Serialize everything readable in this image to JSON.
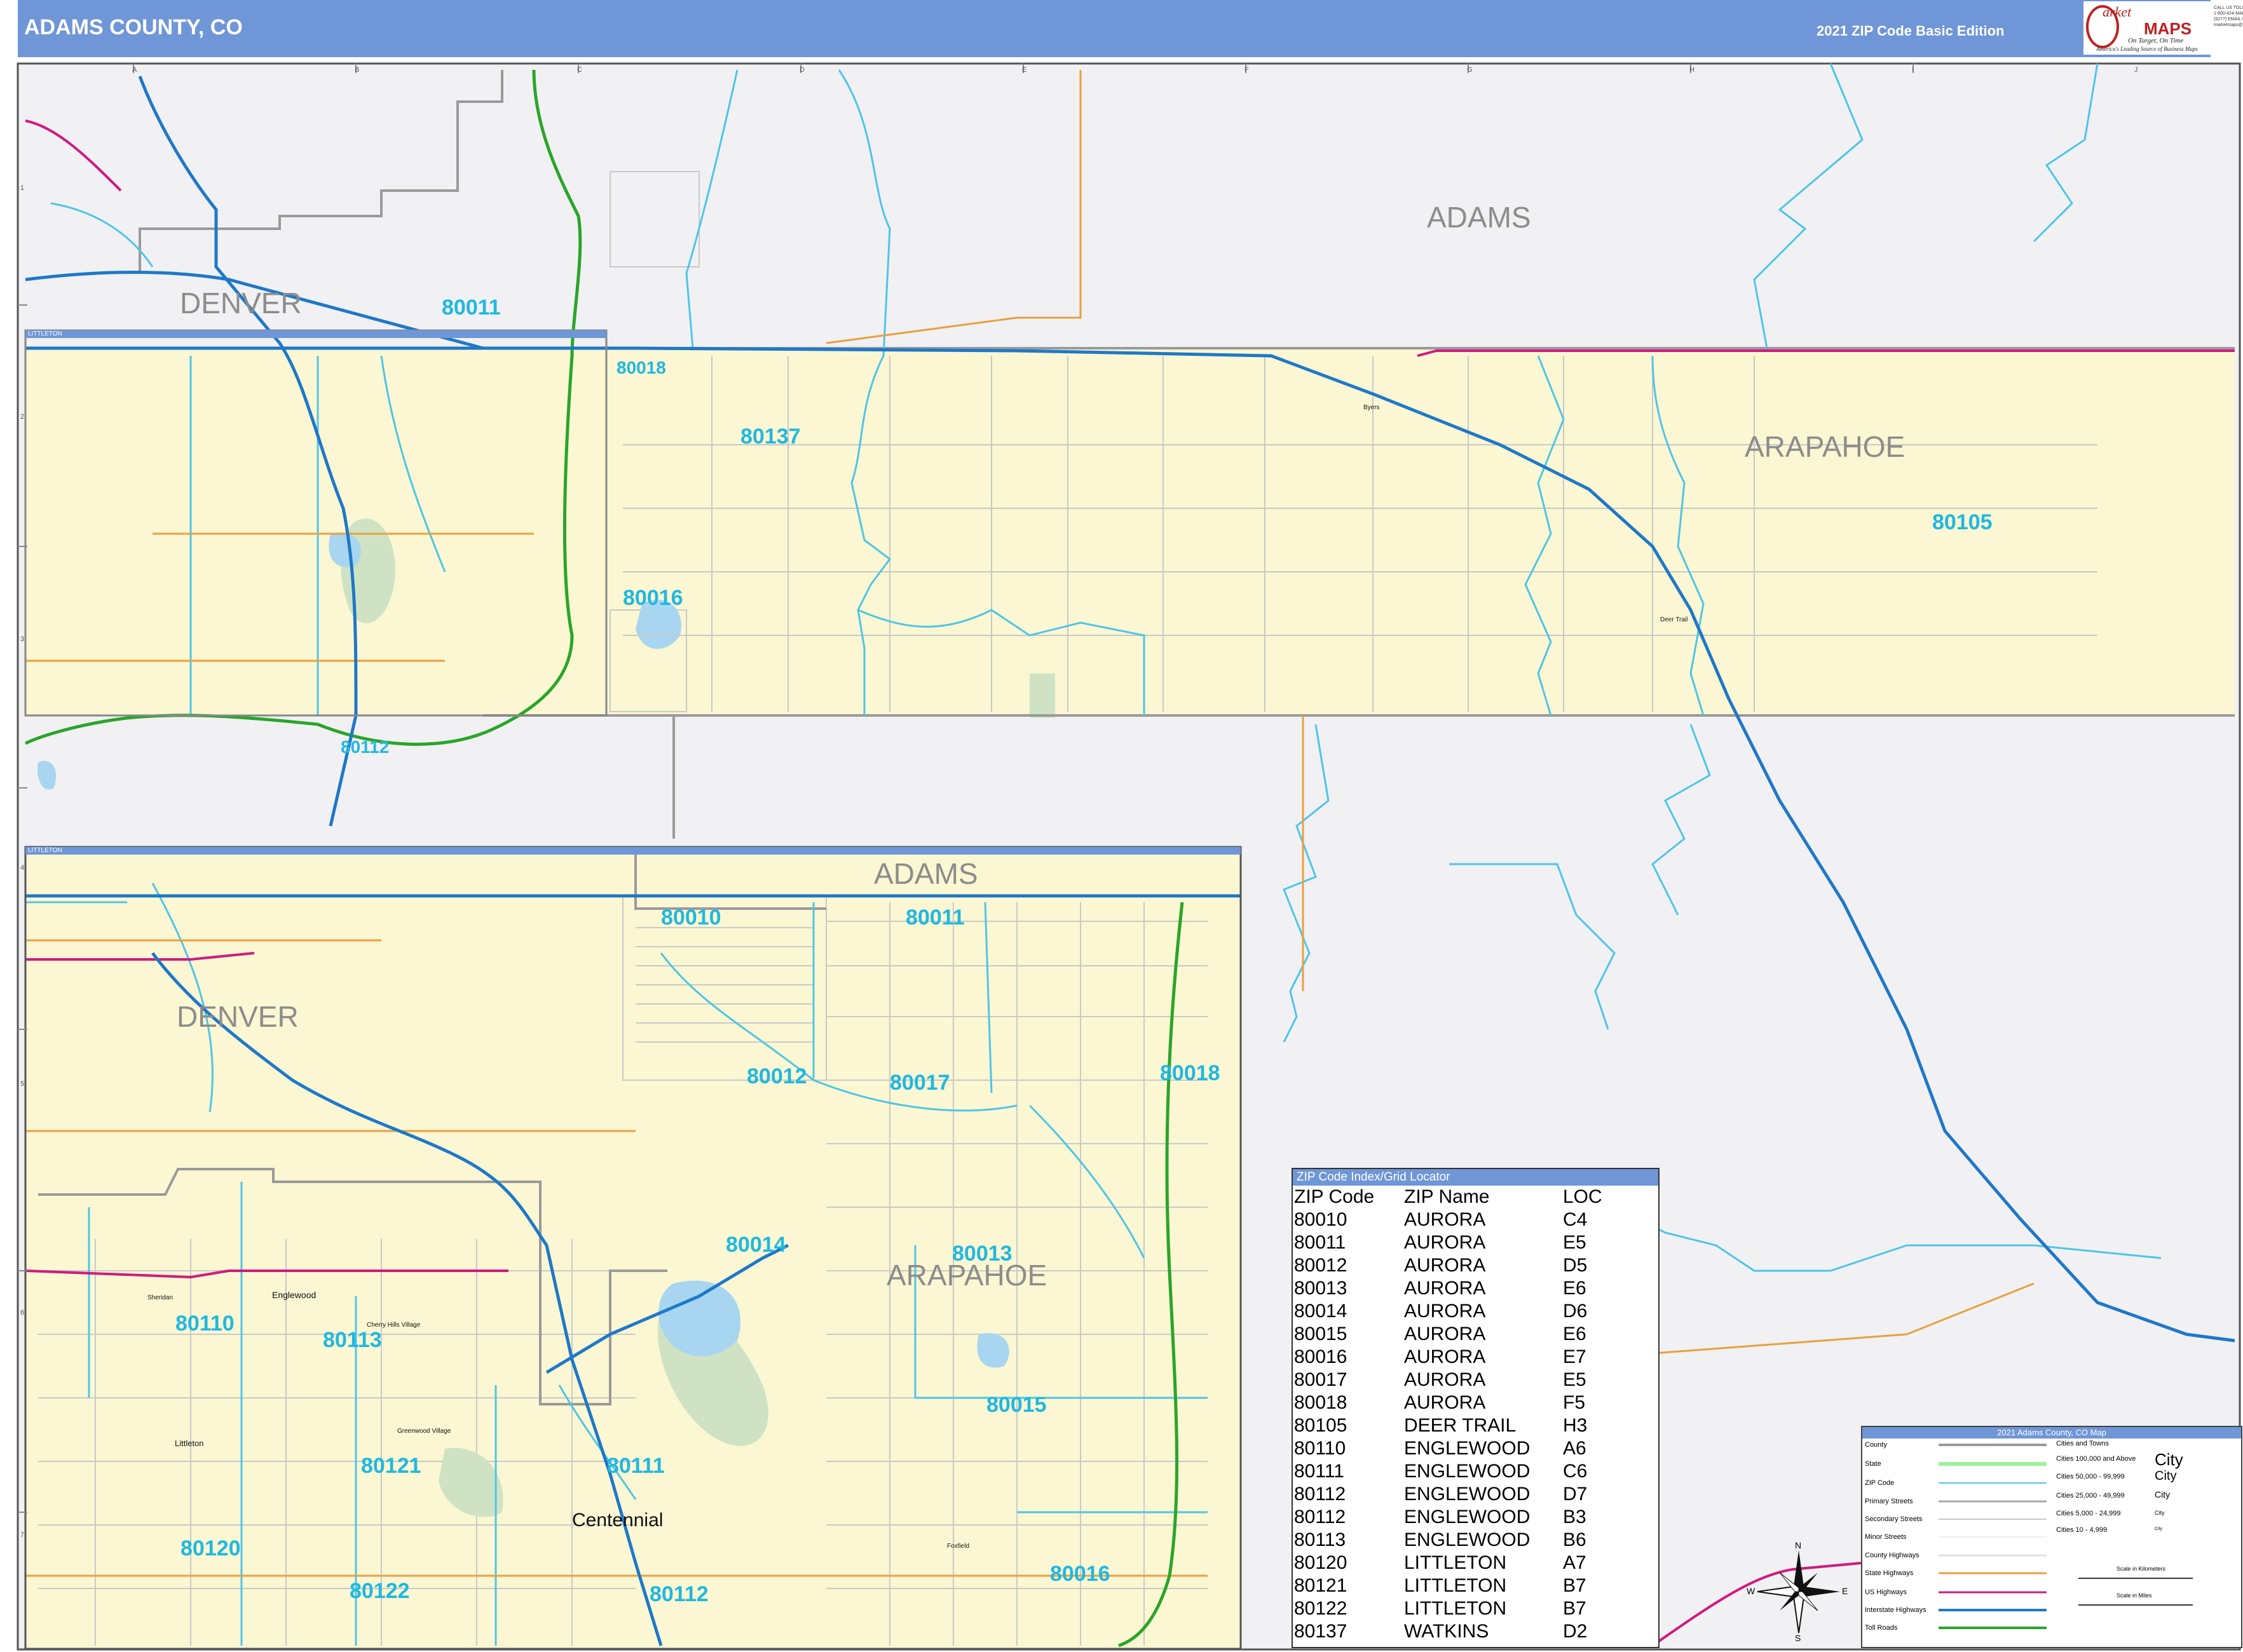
{
  "header": {
    "title": "ADAMS COUNTY, CO",
    "edition": "2021 ZIP Code Basic Edition"
  },
  "logo": {
    "brand_top": "arket",
    "brand_bottom": "MAPS",
    "tagline": "On Target, On Time",
    "subtitle": "America's Leading Source of Business Maps",
    "contact": "CALL US TOLL FREE 1-800-424-MAPS (6277) EMAIL US AT: marketmaps@marketmaps.com"
  },
  "grid": {
    "columns": [
      "A",
      "B",
      "C",
      "D",
      "E",
      "F",
      "G",
      "H",
      "I",
      "J"
    ],
    "rows_main": [
      "1",
      "2",
      "3",
      "4",
      "5",
      "6",
      "7"
    ]
  },
  "county_labels": {
    "adams_top": "ADAMS",
    "denver_top": "DENVER",
    "arapahoe_main": "ARAPAHOE",
    "adams_inset": "ADAMS",
    "denver_inset": "DENVER",
    "arapahoe_inset": "ARAPAHOE"
  },
  "zip_labels": {
    "z80011_top": "80011",
    "z80018_top": "80018",
    "z80137": "80137",
    "z80016_top": "80016",
    "z80105": "80105",
    "z80112_top": "80112",
    "z80010_in": "80010",
    "z80011_in": "80011",
    "z80012_in": "80012",
    "z80017_in": "80017",
    "z80018_in": "80018",
    "z80014_in": "80014",
    "z80013_in": "80013",
    "z80110_in": "80110",
    "z80113_in": "80113",
    "z80015_in": "80015",
    "z80121_in": "80121",
    "z80111_in": "80111",
    "z80120_in": "80120",
    "z80122_in": "80122",
    "z80112_in": "80112",
    "z80016_in": "80016"
  },
  "city_labels": {
    "englewood": "Englewood",
    "centennial": "Centennial",
    "littleton": "Littleton",
    "cherry_hills": "Cherry Hills Village",
    "greenwood": "Greenwood Village",
    "sheridan": "Sheridan",
    "deer_trail": "Deer Trail",
    "foxfield": "Foxfield",
    "byers": "Byers"
  },
  "inset_bars": {
    "top_inset": "LITTLETON",
    "bottom_inset": "LITTLETON"
  },
  "zip_index": {
    "title": "ZIP Code Index/Grid Locator",
    "headers": [
      "ZIP Code",
      "ZIP Name",
      "LOC"
    ],
    "rows": [
      [
        "80010",
        "AURORA",
        "C4"
      ],
      [
        "80011",
        "AURORA",
        "E5"
      ],
      [
        "80012",
        "AURORA",
        "D5"
      ],
      [
        "80013",
        "AURORA",
        "E6"
      ],
      [
        "80014",
        "AURORA",
        "D6"
      ],
      [
        "80015",
        "AURORA",
        "E6"
      ],
      [
        "80016",
        "AURORA",
        "E7"
      ],
      [
        "80017",
        "AURORA",
        "E5"
      ],
      [
        "80018",
        "AURORA",
        "F5"
      ],
      [
        "80105",
        "DEER TRAIL",
        "H3"
      ],
      [
        "80110",
        "ENGLEWOOD",
        "A6"
      ],
      [
        "80111",
        "ENGLEWOOD",
        "C6"
      ],
      [
        "80112",
        "ENGLEWOOD",
        "D7"
      ],
      [
        "80112",
        "ENGLEWOOD",
        "B3"
      ],
      [
        "80113",
        "ENGLEWOOD",
        "B6"
      ],
      [
        "80120",
        "LITTLETON",
        "A7"
      ],
      [
        "80121",
        "LITTLETON",
        "B7"
      ],
      [
        "80122",
        "LITTLETON",
        "B7"
      ],
      [
        "80137",
        "WATKINS",
        "D2"
      ]
    ]
  },
  "legend": {
    "title": "2021 Adams County, CO Map",
    "items": [
      "County",
      "State",
      "ZIP Code",
      "Primary Streets",
      "Secondary Streets",
      "Minor Streets",
      "County Highways",
      "State Highways",
      "US Highways",
      "Interstate Highways",
      "Toll Roads"
    ],
    "cities_title": "Cities and Towns",
    "city_sizes": [
      {
        "range": "Cities 100,000 and Above",
        "sample": "City"
      },
      {
        "range": "Cities 50,000 - 99,999",
        "sample": "City"
      },
      {
        "range": "Cities 25,000 - 49,999",
        "sample": "City"
      },
      {
        "range": "Cities 5,000 - 24,999",
        "sample": "City"
      },
      {
        "range": "Cities 10 - 4,999",
        "sample": "City"
      }
    ],
    "scale_km": "Scale in Kilometers",
    "scale_mi": "Scale in Miles",
    "compass": {
      "n": "N",
      "s": "S",
      "e": "E",
      "w": "W"
    }
  },
  "colors": {
    "header": "#6f96d6",
    "zip_boundary": "#4ec5e8",
    "zip_label": "#20b8e0",
    "county_fill": "#fbf7d2",
    "outside_fill": "#f1f1f3",
    "interstate": "#1f78c8",
    "us_highway": "#d01a80",
    "state_highway": "#e8a040",
    "toll_road": "#2aa52a"
  }
}
